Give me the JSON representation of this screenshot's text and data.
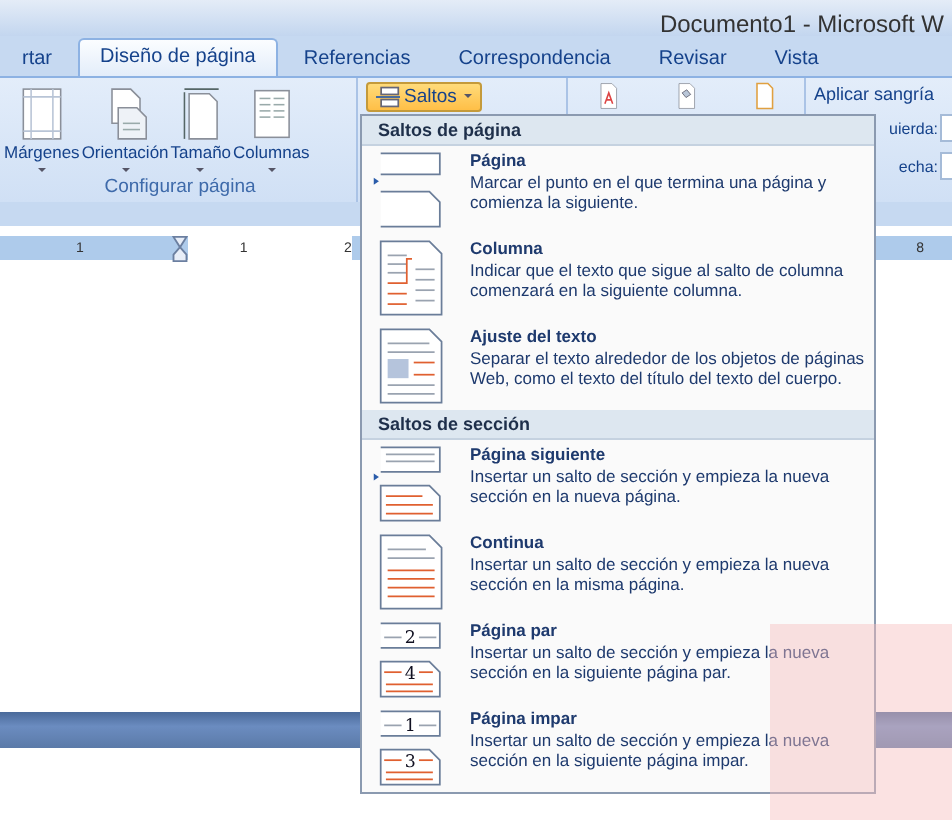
{
  "window": {
    "title": "Documento1 - Microsoft W"
  },
  "tabs": [
    {
      "label": "rtar",
      "selected": false
    },
    {
      "label": "Diseño de página",
      "selected": true
    },
    {
      "label": "Referencias",
      "selected": false
    },
    {
      "label": "Correspondencia",
      "selected": false
    },
    {
      "label": "Revisar",
      "selected": false
    },
    {
      "label": "Vista",
      "selected": false
    }
  ],
  "ribbon": {
    "buttons": [
      {
        "label": "Márgenes",
        "kind": "margins"
      },
      {
        "label": "Orientación",
        "kind": "orientation"
      },
      {
        "label": "Tamaño",
        "kind": "size"
      },
      {
        "label": "Columnas",
        "kind": "columns"
      }
    ],
    "group_label": "Configurar página",
    "breaks_button": {
      "label": "Saltos",
      "open": true
    },
    "indent_label": "Aplicar sangría",
    "left_label": "uierda:",
    "right_label": "echa:"
  },
  "ruler": {
    "left_marks": [
      "1"
    ],
    "right_marks": [
      "1",
      "2"
    ],
    "far_mark": "8"
  },
  "menu": {
    "sections": [
      {
        "title": "Saltos de página",
        "items": [
          {
            "kind": "page",
            "title": "Página",
            "description": "Marcar el punto en el que termina una página y comienza la siguiente."
          },
          {
            "kind": "column",
            "title": "Columna",
            "description": "Indicar que el texto que sigue al salto de columna comenzará en la siguiente columna."
          },
          {
            "kind": "wrap",
            "title": "Ajuste del texto",
            "description": "Separar el texto alrededor de los objetos de páginas Web, como el texto del título del texto del cuerpo."
          }
        ]
      },
      {
        "title": "Saltos de sección",
        "items": [
          {
            "kind": "next",
            "title": "Página siguiente",
            "description": "Insertar un salto de sección y empieza la nueva sección en la nueva página."
          },
          {
            "kind": "continuous",
            "title": "Continua",
            "description": "Insertar un salto de sección y empieza la nueva sección en la misma página."
          },
          {
            "kind": "numbered",
            "title": "Página par",
            "icon_numbers": [
              "2",
              "4"
            ],
            "description": "Insertar un salto de sección y empieza la nueva sección en la siguiente página par."
          },
          {
            "kind": "numbered",
            "title": "Página impar",
            "icon_numbers": [
              "1",
              "3"
            ],
            "description": "Insertar un salto de sección y empieza la nueva sección en la siguiente página impar."
          }
        ]
      }
    ]
  }
}
